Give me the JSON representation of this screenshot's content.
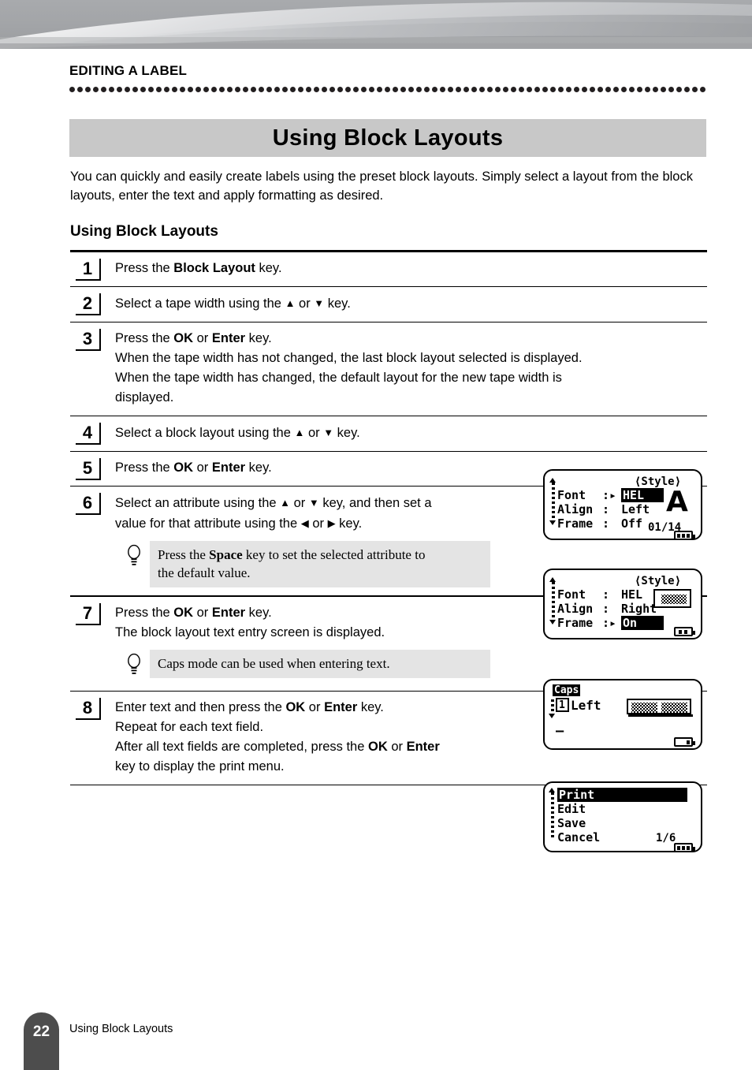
{
  "running_head": "EDITING A LABEL",
  "title": "Using Block Layouts",
  "intro": "You can quickly and easily create labels using the preset block layouts. Simply select a layout from the block layouts, enter the text and apply formatting as desired.",
  "subhead": "Using Block Layouts",
  "steps": [
    {
      "num": "1",
      "lines": [
        [
          {
            "t": "Press the "
          },
          {
            "t": "Block Layout",
            "b": true
          },
          {
            "t": " key."
          }
        ]
      ]
    },
    {
      "num": "2",
      "lines": [
        [
          {
            "t": "Select a tape width using the "
          },
          {
            "t": "▲",
            "a": true
          },
          {
            "t": " or "
          },
          {
            "t": "▼",
            "a": true
          },
          {
            "t": " key."
          }
        ]
      ]
    },
    {
      "num": "3",
      "lines": [
        [
          {
            "t": "Press the "
          },
          {
            "t": "OK",
            "b": true
          },
          {
            "t": " or "
          },
          {
            "t": "Enter",
            "b": true
          },
          {
            "t": " key."
          }
        ],
        [
          {
            "t": "When the tape width has not changed, the last block layout selected is displayed."
          }
        ],
        [
          {
            "t": "When the tape width has changed, the default layout for the new tape width is"
          }
        ],
        [
          {
            "t": "displayed."
          }
        ]
      ]
    },
    {
      "num": "4",
      "lines": [
        [
          {
            "t": "Select a block layout using the "
          },
          {
            "t": "▲",
            "a": true
          },
          {
            "t": " or "
          },
          {
            "t": "▼",
            "a": true
          },
          {
            "t": " key."
          }
        ]
      ]
    },
    {
      "num": "5",
      "lines": [
        [
          {
            "t": "Press the "
          },
          {
            "t": "OK",
            "b": true
          },
          {
            "t": " or "
          },
          {
            "t": "Enter",
            "b": true
          },
          {
            "t": " key."
          }
        ]
      ]
    },
    {
      "num": "6",
      "lines": [
        [
          {
            "t": "Select an attribute using the "
          },
          {
            "t": "▲",
            "a": true
          },
          {
            "t": " or "
          },
          {
            "t": "▼",
            "a": true
          },
          {
            "t": " key, and then set a"
          }
        ],
        [
          {
            "t": "value for that attribute using the "
          },
          {
            "t": "◀",
            "a": true
          },
          {
            "t": " or "
          },
          {
            "t": "▶",
            "a": true
          },
          {
            "t": " key."
          }
        ]
      ],
      "tip": [
        [
          {
            "t": "Press the "
          },
          {
            "t": "Space",
            "b": true
          },
          {
            "t": " key to set the selected attribute to"
          }
        ],
        [
          {
            "t": "the default value."
          }
        ]
      ]
    },
    {
      "num": "7",
      "lines": [
        [
          {
            "t": "Press the "
          },
          {
            "t": "OK",
            "b": true
          },
          {
            "t": " or "
          },
          {
            "t": "Enter",
            "b": true
          },
          {
            "t": " key."
          }
        ],
        [
          {
            "t": "The block layout text entry screen is displayed."
          }
        ]
      ],
      "tip": [
        [
          {
            "t": "Caps mode can be used when entering text."
          }
        ]
      ]
    },
    {
      "num": "8",
      "lines": [
        [
          {
            "t": "Enter text and then press the "
          },
          {
            "t": "OK",
            "b": true
          },
          {
            "t": " or "
          },
          {
            "t": "Enter",
            "b": true
          },
          {
            "t": " key."
          }
        ],
        [
          {
            "t": "Repeat for each text field."
          }
        ],
        [
          {
            "t": "After all text fields are completed, press the "
          },
          {
            "t": "OK",
            "b": true
          },
          {
            "t": " or "
          },
          {
            "t": "Enter",
            "b": true
          }
        ],
        [
          {
            "t": "key to display the print menu."
          }
        ]
      ]
    }
  ],
  "lcd5": {
    "mode_label": "⟨Style⟩",
    "rows": [
      {
        "label": "Font",
        "sep": ":▸",
        "value": "HEL",
        "selected": true
      },
      {
        "label": "Align",
        "sep": ": ",
        "value": "Left",
        "selected": false
      },
      {
        "label": "Frame",
        "sep": ": ",
        "value": "Off",
        "selected": false
      }
    ],
    "preview_glyph": "A",
    "counter": "01/14",
    "battery_bars": 3
  },
  "lcd6": {
    "mode_label": "⟨Style⟩",
    "rows": [
      {
        "label": "Font",
        "sep": ": ",
        "value": "HEL",
        "selected": false
      },
      {
        "label": "Align",
        "sep": ": ",
        "value": "Right",
        "selected": false
      },
      {
        "label": "Frame",
        "sep": ":▸",
        "value": "On",
        "selected": true
      }
    ],
    "counter": "",
    "battery_bars": 2
  },
  "lcd7": {
    "caps_badge": "Caps",
    "block_num": "1",
    "align_text": "Left",
    "cursor": "—",
    "counter": "",
    "battery_bars": 1
  },
  "lcd8": {
    "menu_items": [
      "Print",
      "Edit",
      "Save",
      "Cancel"
    ],
    "selected_index": 0,
    "counter": "1/6",
    "battery_bars": 3
  },
  "footer": {
    "page_number": "22",
    "section": "Using Block Layouts"
  },
  "colors": {
    "title_bar_bg": "#c8c8c8",
    "tip_bg": "#e4e4e4",
    "footer_tab_bg": "#4d4d4d",
    "rule": "#000000"
  }
}
